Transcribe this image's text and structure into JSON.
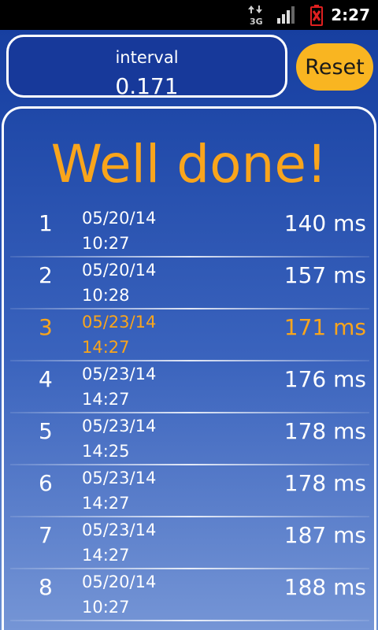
{
  "status_bar": {
    "time": "2:27",
    "icons": [
      "network-3g-icon",
      "signal-icon",
      "battery-alert-icon"
    ],
    "net_label": "3G"
  },
  "header": {
    "interval_label": "interval",
    "interval_value": "0.171",
    "reset_label": "Reset"
  },
  "result": {
    "title": "Well done!"
  },
  "scores": [
    {
      "rank": "1",
      "date": "05/20/14",
      "time": "10:27",
      "value": "140 ms",
      "highlight": false
    },
    {
      "rank": "2",
      "date": "05/20/14",
      "time": "10:28",
      "value": "157 ms",
      "highlight": false
    },
    {
      "rank": "3",
      "date": "05/23/14",
      "time": "14:27",
      "value": "171 ms",
      "highlight": true
    },
    {
      "rank": "4",
      "date": "05/23/14",
      "time": "14:27",
      "value": "176 ms",
      "highlight": false
    },
    {
      "rank": "5",
      "date": "05/23/14",
      "time": "14:25",
      "value": "178 ms",
      "highlight": false
    },
    {
      "rank": "6",
      "date": "05/23/14",
      "time": "14:27",
      "value": "178 ms",
      "highlight": false
    },
    {
      "rank": "7",
      "date": "05/23/14",
      "time": "14:27",
      "value": "187 ms",
      "highlight": false
    },
    {
      "rank": "8",
      "date": "05/20/14",
      "time": "10:27",
      "value": "188 ms",
      "highlight": false
    }
  ],
  "colors": {
    "accent": "#f9a51c",
    "background": "#1f48a8",
    "text": "#ffffff"
  }
}
